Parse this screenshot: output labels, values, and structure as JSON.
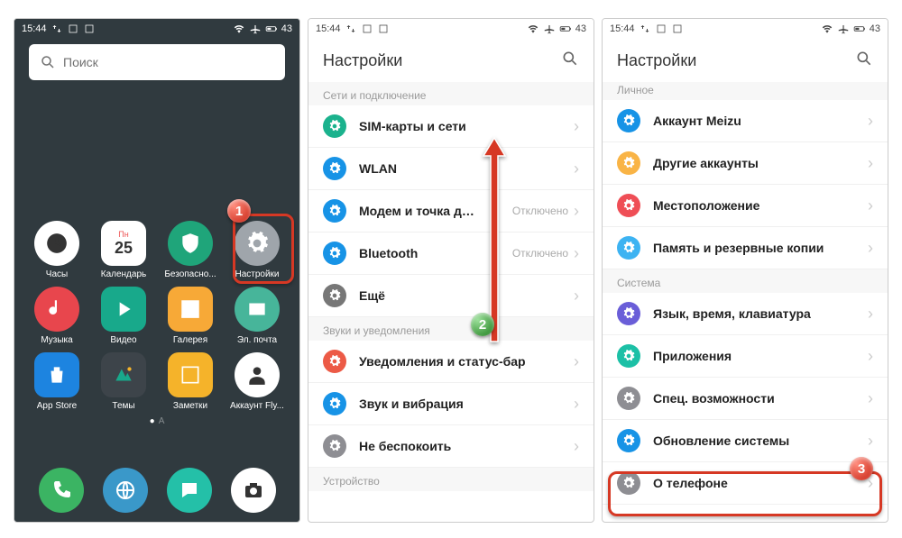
{
  "status": {
    "time": "15:44",
    "battery": "43"
  },
  "home": {
    "search_placeholder": "Поиск",
    "apps": [
      {
        "label": "Часы",
        "shape": "round",
        "bg": "#ffffff"
      },
      {
        "label": "Календарь",
        "shape": "sq",
        "bg": "#ffffff",
        "sub": "25",
        "tag": "Пн"
      },
      {
        "label": "Безопасно...",
        "shape": "round",
        "bg": "#1fa57a"
      },
      {
        "label": "Настройки",
        "shape": "round",
        "bg": "#9fa5ab"
      },
      {
        "label": "Музыка",
        "shape": "round",
        "bg": "#e8464d"
      },
      {
        "label": "Видео",
        "shape": "sq",
        "bg": "#18a98b"
      },
      {
        "label": "Галерея",
        "shape": "sq",
        "bg": "#f7a937"
      },
      {
        "label": "Эл. почта",
        "shape": "round",
        "bg": "#47b59a"
      },
      {
        "label": "App Store",
        "shape": "sq",
        "bg": "#1d84e0"
      },
      {
        "label": "Темы",
        "shape": "sq",
        "bg": "#3d444a"
      },
      {
        "label": "Заметки",
        "shape": "sq",
        "bg": "#f5b32a"
      },
      {
        "label": "Аккаунт Fly...",
        "shape": "round",
        "bg": "#ffffff"
      }
    ],
    "dock": [
      {
        "name": "phone",
        "bg": "#3bb463"
      },
      {
        "name": "browser",
        "bg": "#3a98c9"
      },
      {
        "name": "messages",
        "bg": "#24c0a8"
      },
      {
        "name": "camera",
        "bg": "#ffffff"
      }
    ]
  },
  "settings1": {
    "title": "Настройки",
    "section_network": "Сети и подключение",
    "rows_network": [
      {
        "label": "SIM-карты и сети",
        "value": "",
        "icon_bg": "#1bb28d"
      },
      {
        "label": "WLAN",
        "value": "",
        "icon_bg": "#1793e6"
      },
      {
        "label": "Модем и точка д…",
        "value": "Отключено",
        "icon_bg": "#1793e6"
      },
      {
        "label": "Bluetooth",
        "value": "Отключено",
        "icon_bg": "#1793e6"
      },
      {
        "label": "Ещё",
        "value": "",
        "icon_bg": "#777"
      }
    ],
    "section_sound": "Звуки и уведомления",
    "rows_sound": [
      {
        "label": "Уведомления и статус-бар",
        "value": "",
        "icon_bg": "#ec5a46"
      },
      {
        "label": "Звук и вибрация",
        "value": "",
        "icon_bg": "#1793e6"
      },
      {
        "label": "Не беспокоить",
        "value": "",
        "icon_bg": "#8e8e93"
      }
    ],
    "section_device": "Устройство"
  },
  "settings2": {
    "title": "Настройки",
    "section_personal": "Личное",
    "rows_personal": [
      {
        "label": "Аккаунт Meizu",
        "icon_bg": "#1793e6"
      },
      {
        "label": "Другие аккаунты",
        "icon_bg": "#f9b446"
      },
      {
        "label": "Местоположение",
        "icon_bg": "#ef4e56"
      },
      {
        "label": "Память и резервные копии",
        "icon_bg": "#3db3f2"
      }
    ],
    "section_system": "Система",
    "rows_system": [
      {
        "label": "Язык, время, клавиатура",
        "icon_bg": "#6a5ed8"
      },
      {
        "label": "Приложения",
        "icon_bg": "#1cc0a6"
      },
      {
        "label": "Спец. возможности",
        "icon_bg": "#8e8e93"
      },
      {
        "label": "Обновление системы",
        "icon_bg": "#1793e6"
      },
      {
        "label": "О телефоне",
        "icon_bg": "#8e8e93"
      }
    ]
  },
  "badges": {
    "b1": "1",
    "b2": "2",
    "b3": "3"
  }
}
